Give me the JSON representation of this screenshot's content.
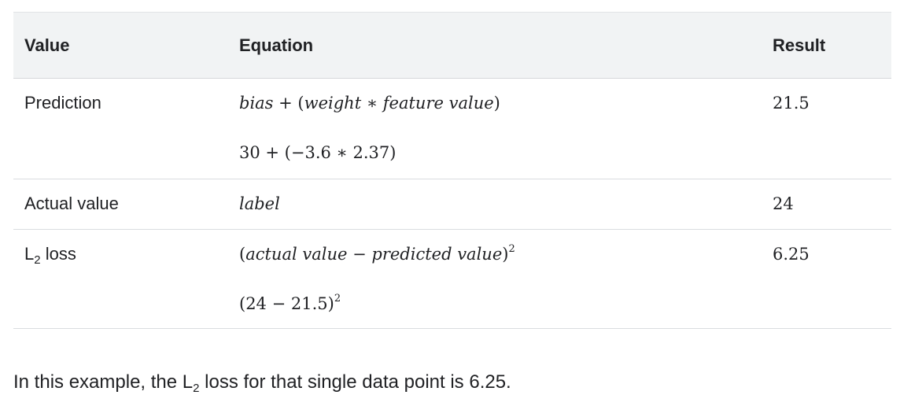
{
  "table": {
    "headers": {
      "value": "Value",
      "equation": "Equation",
      "result": "Result"
    },
    "rows": [
      {
        "label": "Prediction",
        "formula": {
          "bias": "bias",
          "plus": " + (",
          "weight": "weight",
          "times": " ∗ ",
          "feature": "feature value",
          "close": ")"
        },
        "substituted": "30 + (−3.6 ∗ 2.37)",
        "result": "21.5"
      },
      {
        "label": "Actual value",
        "formula": {
          "label_var": "label"
        },
        "result": "24"
      },
      {
        "label_main": "L",
        "label_sub": "2",
        "label_rest": " loss",
        "formula": {
          "open": "(",
          "actual": "actual value",
          "minus": " − ",
          "predicted": "predicted value",
          "close": ")",
          "exp": "2"
        },
        "substituted": {
          "base": "(24 − 21.5)",
          "exp": "2"
        },
        "result": "6.25"
      }
    ]
  },
  "paragraph": {
    "before": "In this example, the L",
    "sub": "2",
    "after": " loss for that single data point is 6.25."
  }
}
